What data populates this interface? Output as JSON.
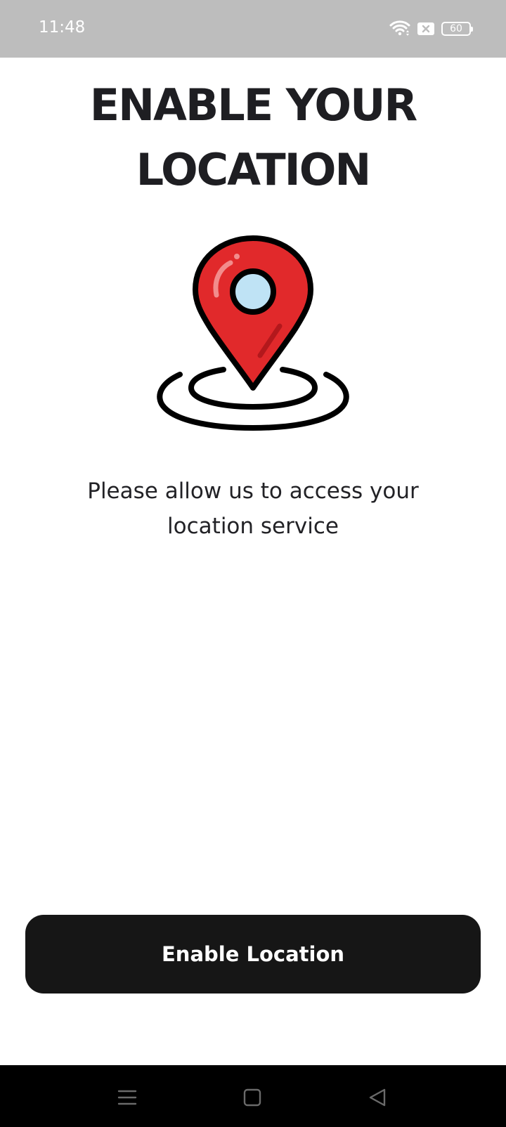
{
  "status_bar": {
    "time": "11:48",
    "battery_level": "60",
    "icons": [
      "wifi-icon",
      "sim-blocked-icon",
      "battery-icon"
    ]
  },
  "page": {
    "title_line1": "ENABLE YOUR",
    "title_line2": "LOCATION",
    "illustration": "location-pin-icon",
    "description_line1": "Please allow us to access your",
    "description_line2": "location service"
  },
  "actions": {
    "enable_label": "Enable Location"
  },
  "nav_bar": {
    "items": [
      "menu-icon",
      "home-icon",
      "back-icon"
    ]
  },
  "colors": {
    "status_bar_bg": "#bdbdbd",
    "pin_red": "#e1292b",
    "pin_center": "#bfe3f5",
    "button_bg": "#161616",
    "nav_bar_bg": "#000000"
  }
}
